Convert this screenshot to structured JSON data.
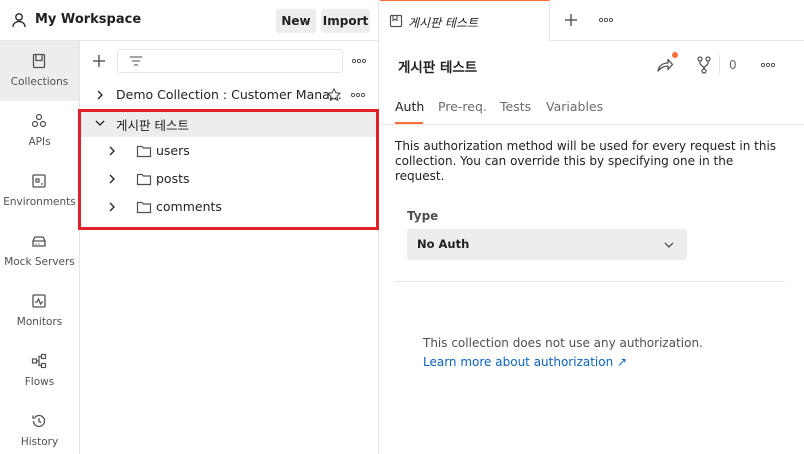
{
  "workspace": {
    "title": "My Workspace",
    "new_label": "New",
    "import_label": "Import"
  },
  "sidebar": {
    "items": [
      {
        "label": "Collections",
        "icon": "collections-icon",
        "active": true
      },
      {
        "label": "APIs",
        "icon": "apis-icon"
      },
      {
        "label": "Environments",
        "icon": "environments-icon"
      },
      {
        "label": "Mock Servers",
        "icon": "mock-servers-icon"
      },
      {
        "label": "Monitors",
        "icon": "monitors-icon"
      },
      {
        "label": "Flows",
        "icon": "flows-icon"
      },
      {
        "label": "History",
        "icon": "history-icon"
      }
    ]
  },
  "collections": {
    "items": [
      {
        "name": "Demo Collection : Customer Mana...",
        "expanded": false
      },
      {
        "name": "게시판 테스트",
        "expanded": true,
        "folders": [
          {
            "name": "users"
          },
          {
            "name": "posts"
          },
          {
            "name": "comments"
          }
        ]
      }
    ]
  },
  "tab": {
    "title": "게시판 테스트"
  },
  "collection_view": {
    "title": "게시판 테스트",
    "fork_count": "0",
    "sub_tabs": [
      "Auth",
      "Pre-req.",
      "Tests",
      "Variables"
    ],
    "active_sub_tab": "Auth",
    "description": "This authorization method will be used for every request in this collection. You can override this by specifying one in the request.",
    "type_label": "Type",
    "type_value": "No Auth",
    "no_auth_text": "This collection does not use any authorization.",
    "learn_link": "Learn more about authorization ↗"
  },
  "colors": {
    "accent": "#ff6c37",
    "link": "#0b63c1",
    "highlight_box": "#e2202a"
  }
}
